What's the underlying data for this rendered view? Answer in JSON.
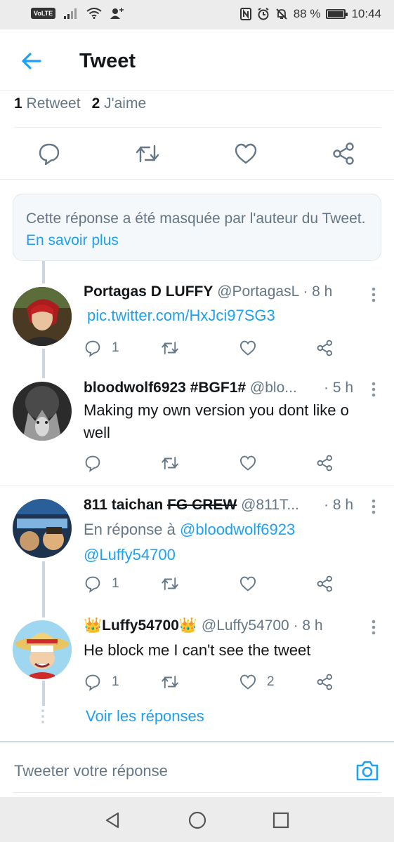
{
  "status_bar": {
    "volte": "VoLTE",
    "battery_text": "88 %",
    "battery_level": 0.88,
    "time": "10:44"
  },
  "header": {
    "title": "Tweet"
  },
  "stats": {
    "retweet_count": "1",
    "retweet_label": "Retweet",
    "like_count": "2",
    "like_label": "J'aime"
  },
  "hidden_notice": {
    "text": "Cette réponse a été masquée par l'auteur du Tweet.",
    "link": "En savoir plus"
  },
  "replies": [
    {
      "name": "Portagas D LUFFY",
      "handle": "@PortagasL",
      "time": "· 8 h",
      "link_text": "pic.twitter.com/HxJci97SG3",
      "reply_count": "1",
      "retweet_count": "",
      "like_count": ""
    },
    {
      "name": "bloodwolf6923 #BGF1#",
      "handle": "@blo...",
      "time": "· 5 h",
      "text": "Making my own version you dont like o well",
      "reply_count": "",
      "retweet_count": "",
      "like_count": ""
    },
    {
      "name_main": "811 taichan",
      "name_strike": "FG CREW",
      "handle": "@811T...",
      "time": "· 8 h",
      "reply_prefix": "En réponse à",
      "mention_1": "@bloodwolf6923",
      "mention_2": "@Luffy54700",
      "reply_count": "1",
      "retweet_count": "",
      "like_count": ""
    },
    {
      "name": "Luffy54700",
      "name_emoji": "👑",
      "handle": "@Luffy54700",
      "time": "· 8 h",
      "text": "He block me I can't see the tweet",
      "reply_count": "1",
      "retweet_count": "",
      "like_count": "2"
    }
  ],
  "see_replies": "Voir les réponses",
  "compose": {
    "placeholder": "Tweeter votre réponse"
  },
  "icons": {
    "back": "arrow-left-icon",
    "reply": "comment-icon",
    "retweet": "retweet-icon",
    "like": "heart-icon",
    "share": "share-icon",
    "camera": "camera-icon"
  },
  "colors": {
    "accent": "#1da1f2",
    "secondary_text": "#657786",
    "primary_text": "#14171a",
    "border": "#e6ecf0"
  }
}
